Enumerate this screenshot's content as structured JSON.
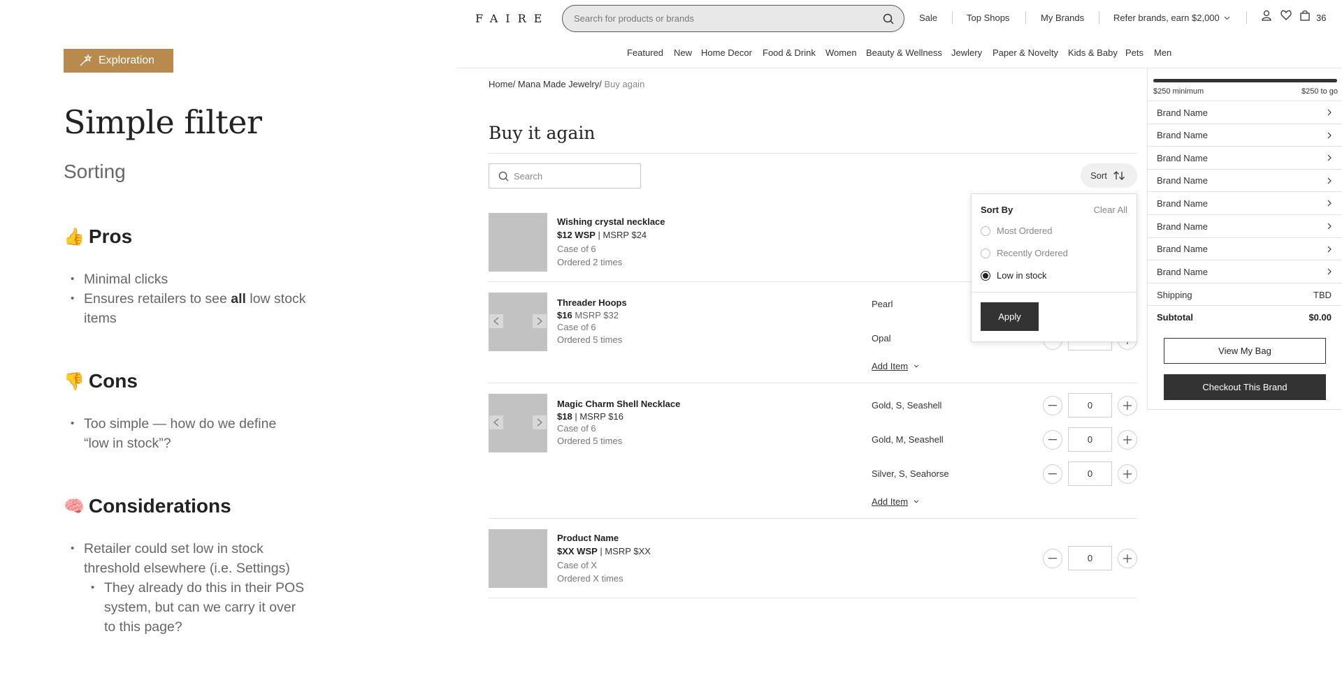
{
  "annotation": {
    "tag": "Exploration",
    "title": "Simple filter",
    "subtitle": "Sorting",
    "pros": {
      "emoji": "👍",
      "heading": "Pros",
      "items": [
        "Minimal clicks",
        "Ensures retailers to see ",
        "all",
        " low stock",
        "items"
      ]
    },
    "cons": {
      "emoji": "👎",
      "heading": "Cons",
      "items": [
        "Too simple — how do we define",
        "“low in stock”?"
      ]
    },
    "considerations": {
      "emoji": "🧠",
      "heading": "Considerations",
      "items": [
        "Retailer could set low in stock",
        "threshold elsewhere (i.e. Settings)",
        "They already do this in their POS",
        "system, but can we carry it over",
        "to this page?"
      ]
    }
  },
  "header": {
    "logo": "FAIRE",
    "search_placeholder": "Search for products or brands",
    "links": [
      "Sale",
      "Top Shops",
      "My Brands",
      "Refer brands, earn $2,000"
    ],
    "bag_count": "36"
  },
  "categories": [
    "Featured",
    "New",
    "Home Decor",
    "Food & Drink",
    "Women",
    "Beauty & Wellness",
    "Jewlery",
    "Paper & Novelty",
    "Kids & Baby",
    "Pets",
    "Men"
  ],
  "breadcrumb": [
    "Home",
    "Mana Made Jewelry",
    "Buy again"
  ],
  "page": {
    "title": "Buy it again",
    "search_placeholder": "Search",
    "sort_label": "Sort"
  },
  "sort_menu": {
    "title": "Sort By",
    "clear": "Clear All",
    "options": [
      "Most Ordered",
      "Recently Ordered",
      "Low in stock"
    ],
    "selected": "Low in stock",
    "apply": "Apply"
  },
  "products": [
    {
      "name": "Wishing crystal necklace",
      "wsp": "$12 WSP",
      "msrp": "MSRP $24",
      "case": "Case of 6",
      "ordered": "Ordered 2 times"
    },
    {
      "name": "Threader Hoops",
      "wsp": "$16",
      "msrp": "MSRP $32",
      "case": "Case of 6",
      "ordered": "Ordered 5 times",
      "variants": [
        {
          "name": "Pearl"
        },
        {
          "name": "Opal"
        }
      ],
      "add_item": "Add Item"
    },
    {
      "name": "Magic Charm Shell Necklace",
      "wsp": "$18",
      "msrp": "MSRP $16",
      "case": "Case of 6",
      "ordered": "Ordered 5 times",
      "variants": [
        {
          "name": "Gold, S, Seashell",
          "qty": "0"
        },
        {
          "name": "Gold, M, Seashell",
          "qty": "0"
        },
        {
          "name": "Silver, S, Seahorse",
          "qty": "0"
        }
      ],
      "add_item": "Add Item"
    },
    {
      "name": "Product Name",
      "wsp": "$XX WSP",
      "msrp": "MSRP $XX",
      "case": "Case of X",
      "ordered": "Ordered X times",
      "qty": "0"
    }
  ],
  "bag": {
    "progress": 1.0,
    "minimum": "$250 minimum",
    "to_go": "$250 to go",
    "brands": [
      "Brand Name",
      "Brand Name",
      "Brand Name",
      "Brand Name",
      "Brand Name",
      "Brand Name",
      "Brand Name",
      "Brand Name"
    ],
    "shipping_label": "Shipping",
    "shipping_value": "TBD",
    "subtotal_label": "Subtotal",
    "subtotal_value": "$0.00",
    "view_bag": "View My Bag",
    "checkout": "Checkout This Brand"
  },
  "colors": {
    "tag": "#b98a4e",
    "dark_button": "#333333",
    "thumb": "#c2c2c2"
  }
}
